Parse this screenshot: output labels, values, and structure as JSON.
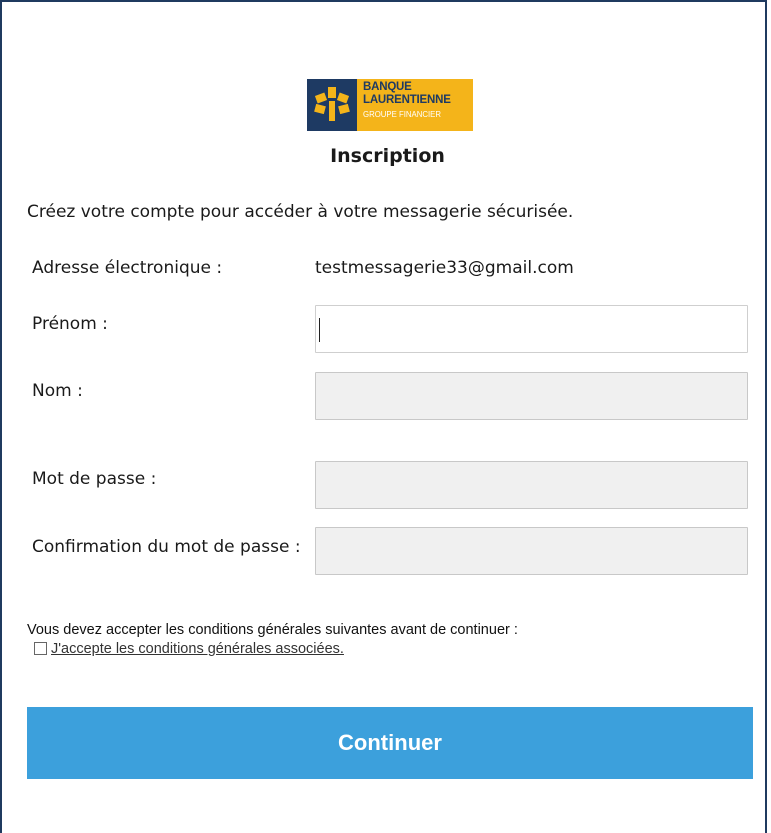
{
  "brand": {
    "line1": "BANQUE",
    "line2": "LAURENTIENNE",
    "line3": "GROUPE FINANCIER",
    "navy": "#1e3a63",
    "gold": "#f4b41a"
  },
  "page": {
    "title": "Inscription",
    "intro": "Créez votre compte pour accéder à votre messagerie sécurisée."
  },
  "form": {
    "email_label": "Adresse électronique :",
    "email_value": "testmessagerie33@gmail.com",
    "firstname_label": "Prénom :",
    "firstname_value": "",
    "lastname_label": "Nom :",
    "lastname_value": "",
    "password_label": "Mot de passe :",
    "password_value": "",
    "confirm_label": "Confirmation du mot de passe :",
    "confirm_value": ""
  },
  "terms": {
    "notice": "Vous devez accepter les conditions générales suivantes avant de continuer :",
    "checkbox_label": "J'accepte les conditions générales associées.",
    "checked": false
  },
  "actions": {
    "continue_label": "Continuer",
    "button_color": "#3ca0dc"
  }
}
